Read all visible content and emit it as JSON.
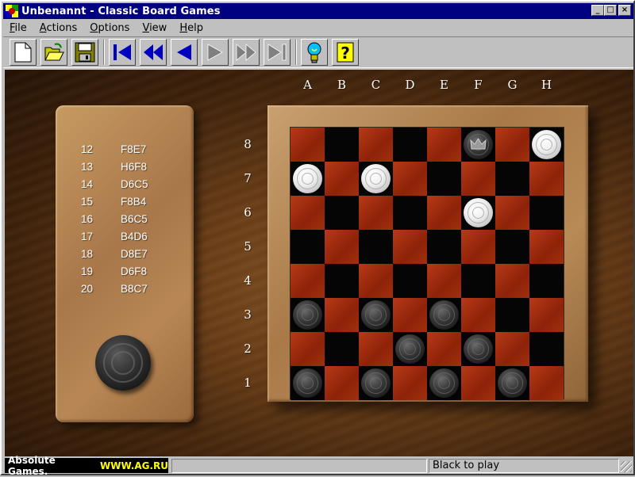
{
  "window": {
    "title": "Unbenannt - Classic Board Games",
    "minimize": "_",
    "maximize": "□",
    "close": "×"
  },
  "menu": {
    "file": {
      "u": "F",
      "rest": "ile"
    },
    "actions": {
      "u": "A",
      "rest": "ctions"
    },
    "options": {
      "u": "O",
      "rest": "ptions"
    },
    "view": {
      "u": "V",
      "rest": "iew"
    },
    "help": {
      "u": "H",
      "rest": "elp"
    }
  },
  "toolbar": {
    "icons": [
      "new-document-icon",
      "open-folder-icon",
      "save-disk-icon",
      "first-move-icon",
      "rewind-icon",
      "step-back-icon",
      "step-forward-icon",
      "fast-forward-icon",
      "last-move-icon",
      "hint-lightbulb-icon",
      "help-question-icon"
    ]
  },
  "moves": [
    {
      "num": "12",
      "move": "F8E7"
    },
    {
      "num": "13",
      "move": "H6F8"
    },
    {
      "num": "14",
      "move": "D6C5"
    },
    {
      "num": "15",
      "move": "F8B4"
    },
    {
      "num": "16",
      "move": "B6C5"
    },
    {
      "num": "17",
      "move": "B4D6"
    },
    {
      "num": "18",
      "move": "D8E7"
    },
    {
      "num": "19",
      "move": "D6F8"
    },
    {
      "num": "20",
      "move": "B8C7"
    }
  ],
  "board": {
    "columns": [
      "A",
      "B",
      "C",
      "D",
      "E",
      "F",
      "G",
      "H"
    ],
    "rows": [
      "8",
      "7",
      "6",
      "5",
      "4",
      "3",
      "2",
      "1"
    ],
    "pieces": [
      {
        "square": "F8",
        "color": "dark",
        "king": true
      },
      {
        "square": "H8",
        "color": "white",
        "king": false
      },
      {
        "square": "A7",
        "color": "white",
        "king": false
      },
      {
        "square": "C7",
        "color": "white",
        "king": false
      },
      {
        "square": "F6",
        "color": "white",
        "king": false
      },
      {
        "square": "A3",
        "color": "dark",
        "king": false
      },
      {
        "square": "C3",
        "color": "dark",
        "king": false
      },
      {
        "square": "E3",
        "color": "dark",
        "king": false
      },
      {
        "square": "D2",
        "color": "dark",
        "king": false
      },
      {
        "square": "F2",
        "color": "dark",
        "king": false
      },
      {
        "square": "A1",
        "color": "dark",
        "king": false
      },
      {
        "square": "C1",
        "color": "dark",
        "king": false
      },
      {
        "square": "E1",
        "color": "dark",
        "king": false
      },
      {
        "square": "G1",
        "color": "dark",
        "king": false
      }
    ],
    "colors": {
      "light_square": "#a0300f",
      "dark_square": "#050505"
    }
  },
  "turn_indicator": {
    "color": "dark"
  },
  "status": {
    "left": "",
    "right": "Black to play"
  },
  "badge": {
    "name": "Absolute Games.",
    "url": "WWW.AG.RU"
  }
}
